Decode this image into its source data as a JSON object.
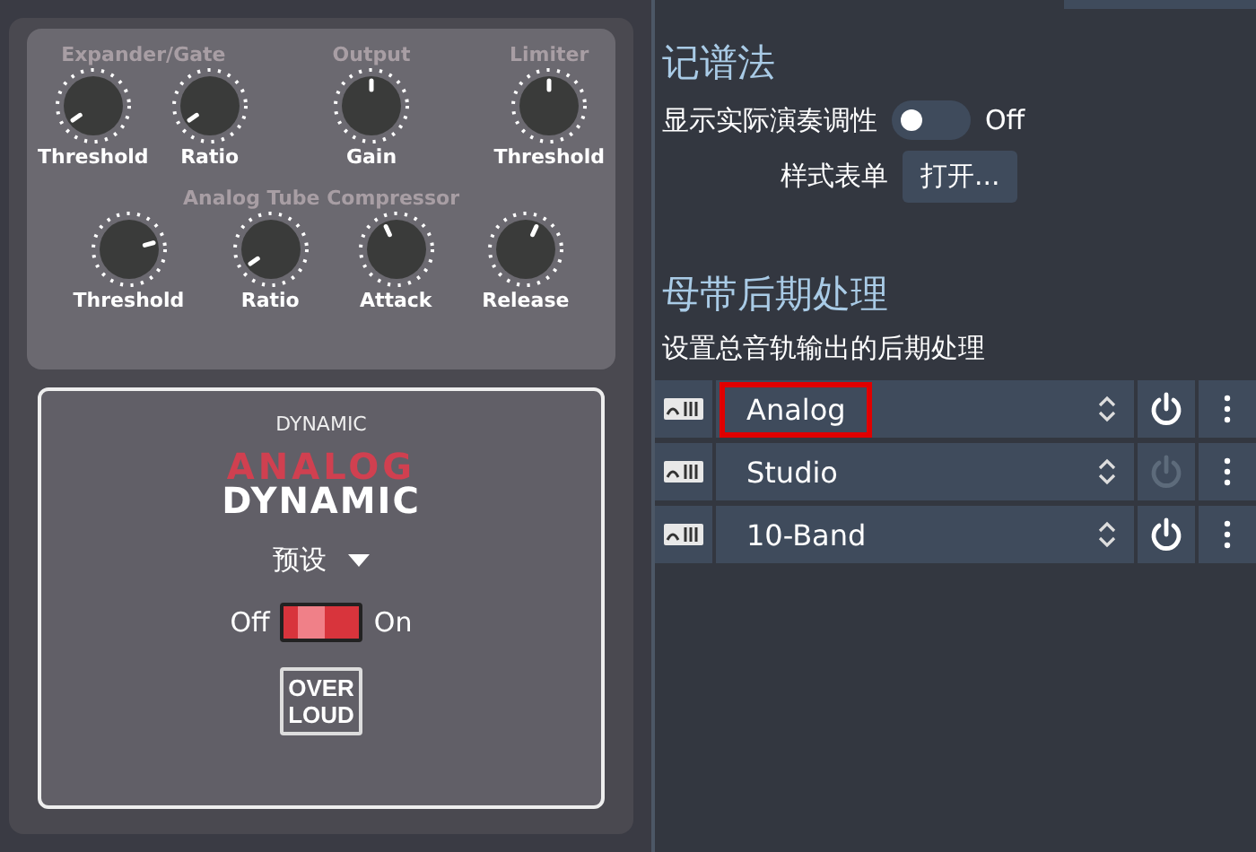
{
  "plugin": {
    "groups": [
      {
        "title": "Expander/Gate",
        "knobs": [
          {
            "label": "Threshold"
          },
          {
            "label": "Ratio"
          }
        ]
      },
      {
        "title": "Output",
        "knobs": [
          {
            "label": "Gain"
          }
        ]
      },
      {
        "title": "Limiter",
        "knobs": [
          {
            "label": "Threshold"
          }
        ]
      }
    ],
    "compressor": {
      "title": "Analog Tube Compressor",
      "knobs": [
        {
          "label": "Threshold"
        },
        {
          "label": "Ratio"
        },
        {
          "label": "Attack"
        },
        {
          "label": "Release"
        }
      ]
    },
    "card": {
      "caption": "DYNAMIC",
      "logo_top": "ANALOG",
      "logo_bottom": "DYNAMIC",
      "preset": "预设",
      "off_label": "Off",
      "on_label": "On",
      "on": true,
      "badge_top": "OVER",
      "badge_bottom": "LOUD"
    }
  },
  "notation": {
    "heading": "记谱法",
    "toggle_label": "显示实际演奏调性",
    "toggle_on": false,
    "toggle_state": "Off",
    "style_label": "样式表单",
    "style_button": "打开..."
  },
  "mastering": {
    "heading": "母带后期处理",
    "description": "设置总音轨输出的后期处理",
    "rows": [
      {
        "name": "Analog",
        "selected": true,
        "on": true
      },
      {
        "name": "Studio",
        "selected": false,
        "on": false
      },
      {
        "name": "10-Band",
        "selected": false,
        "on": true
      }
    ]
  }
}
